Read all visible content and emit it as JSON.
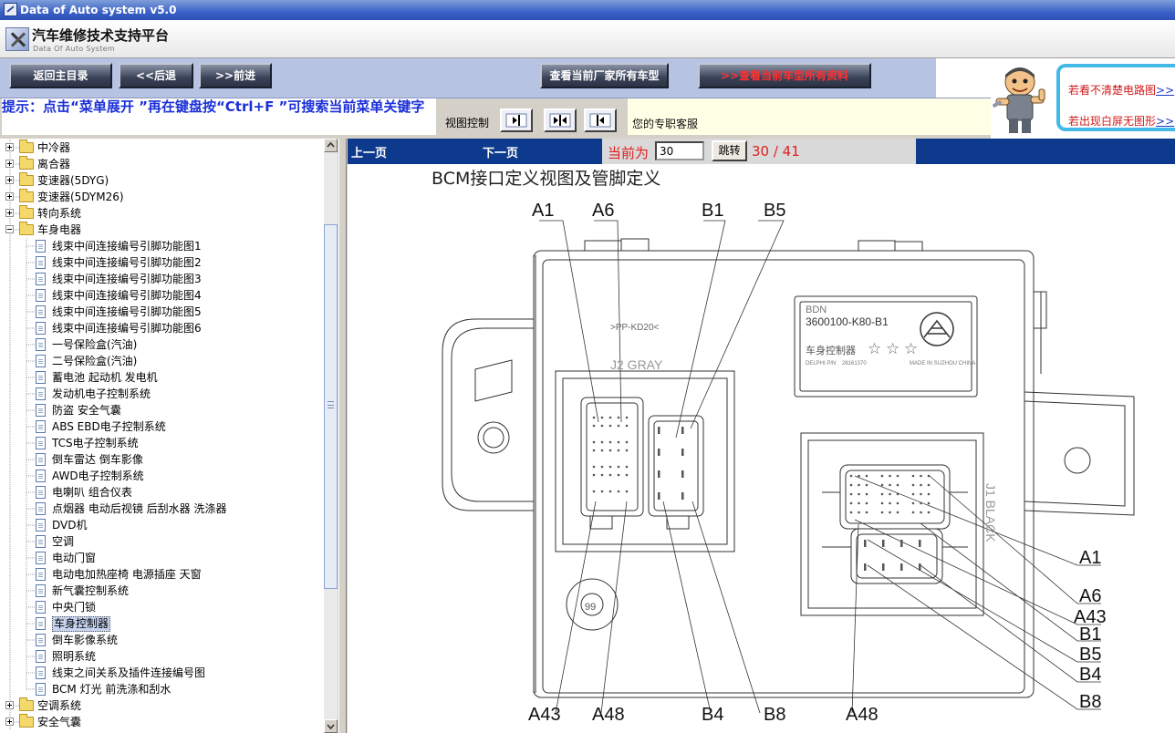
{
  "window": {
    "title": "Data of Auto system v5.0"
  },
  "header": {
    "title": "汽车维修技术支持平台",
    "subtitle": "Data Of Auto System"
  },
  "toolbar": {
    "home": "返回主目录",
    "back": "<<后退",
    "forward": ">>前进",
    "models": "查看当前厂家所有车型",
    "all_data": "查看当前车型所有资料"
  },
  "hint": "提示：点击“菜单展开 ”再在键盘按“Ctrl+F ”可搜索当前菜单关键字",
  "view_control": {
    "label": "视图控制"
  },
  "service": "您的专职客服",
  "promo": {
    "line1": "若看不清楚电路图",
    "line2": "若出现白屏无图形",
    "more": ">>"
  },
  "tree": [
    {
      "label": "中冷器",
      "type": "folder",
      "level": 0,
      "expanded": false
    },
    {
      "label": "离合器",
      "type": "folder",
      "level": 0,
      "expanded": false
    },
    {
      "label": "变速器(5DYG)",
      "type": "folder",
      "level": 0,
      "expanded": false
    },
    {
      "label": "变速器(5DYM26)",
      "type": "folder",
      "level": 0,
      "expanded": false
    },
    {
      "label": "转向系统",
      "type": "folder",
      "level": 0,
      "expanded": false
    },
    {
      "label": "车身电器",
      "type": "folder",
      "level": 0,
      "expanded": true
    },
    {
      "label": "线束中间连接编号引脚功能图1",
      "type": "doc",
      "level": 1
    },
    {
      "label": "线束中间连接编号引脚功能图2",
      "type": "doc",
      "level": 1
    },
    {
      "label": "线束中间连接编号引脚功能图3",
      "type": "doc",
      "level": 1
    },
    {
      "label": "线束中间连接编号引脚功能图4",
      "type": "doc",
      "level": 1
    },
    {
      "label": "线束中间连接编号引脚功能图5",
      "type": "doc",
      "level": 1
    },
    {
      "label": "线束中间连接编号引脚功能图6",
      "type": "doc",
      "level": 1
    },
    {
      "label": "一号保险盒(汽油)",
      "type": "doc",
      "level": 1
    },
    {
      "label": "二号保险盒(汽油)",
      "type": "doc",
      "level": 1
    },
    {
      "label": "蓄电池 起动机 发电机",
      "type": "doc",
      "level": 1
    },
    {
      "label": "发动机电子控制系统",
      "type": "doc",
      "level": 1
    },
    {
      "label": "防盗 安全气囊",
      "type": "doc",
      "level": 1
    },
    {
      "label": "ABS EBD电子控制系统",
      "type": "doc",
      "level": 1
    },
    {
      "label": "TCS电子控制系统",
      "type": "doc",
      "level": 1
    },
    {
      "label": "倒车雷达 倒车影像",
      "type": "doc",
      "level": 1
    },
    {
      "label": "AWD电子控制系统",
      "type": "doc",
      "level": 1
    },
    {
      "label": "电喇叭 组合仪表",
      "type": "doc",
      "level": 1
    },
    {
      "label": "点烟器 电动后视镜 后刮水器 洗涤器",
      "type": "doc",
      "level": 1
    },
    {
      "label": "DVD机",
      "type": "doc",
      "level": 1
    },
    {
      "label": "空调",
      "type": "doc",
      "level": 1
    },
    {
      "label": "电动门窗",
      "type": "doc",
      "level": 1
    },
    {
      "label": "电动电加热座椅 电源插座 天窗",
      "type": "doc",
      "level": 1
    },
    {
      "label": "新气囊控制系统",
      "type": "doc",
      "level": 1
    },
    {
      "label": "中央门锁",
      "type": "doc",
      "level": 1
    },
    {
      "label": "车身控制器",
      "type": "doc",
      "level": 1,
      "selected": true
    },
    {
      "label": "倒车影像系统",
      "type": "doc",
      "level": 1
    },
    {
      "label": "照明系统",
      "type": "doc",
      "level": 1
    },
    {
      "label": "线束之间关系及插件连接编号图",
      "type": "doc",
      "level": 1
    },
    {
      "label": "BCM 灯光 前洗涤和刮水",
      "type": "doc",
      "level": 1
    },
    {
      "label": "空调系统",
      "type": "folder",
      "level": 0,
      "expanded": false
    },
    {
      "label": "安全气囊",
      "type": "folder",
      "level": 0,
      "expanded": false
    }
  ],
  "pager": {
    "prev": "上一页",
    "next": "下一页",
    "current_label": "当前为",
    "current_page": "30",
    "jump": "跳转",
    "page_count": "30 / 41"
  },
  "diagram": {
    "title": "BCM接口定义视图及管脚定义",
    "top_labels": [
      "A1",
      "A6",
      "B1",
      "B5"
    ],
    "bottom_labels": [
      "A43",
      "A48",
      "B4",
      "B8",
      "A48"
    ],
    "right_labels": [
      "A1",
      "A6",
      "A43",
      "B1",
      "B5",
      "B4",
      "B8"
    ],
    "part_brand": "BDN",
    "part_number": "3600100-K80-B1",
    "part_name": "车身控制器",
    "part_maker": "DELPHI P/N",
    "part_date_code": "28161370",
    "part_origin": "MADE IN SUZHOU CHINA",
    "connector_j2": "J2 GRAY",
    "connector_j1": "J1 BLACK",
    "material_mark": ">PP-KD20<",
    "date_wheel": "99",
    "stars": "☆ ☆ ☆"
  }
}
